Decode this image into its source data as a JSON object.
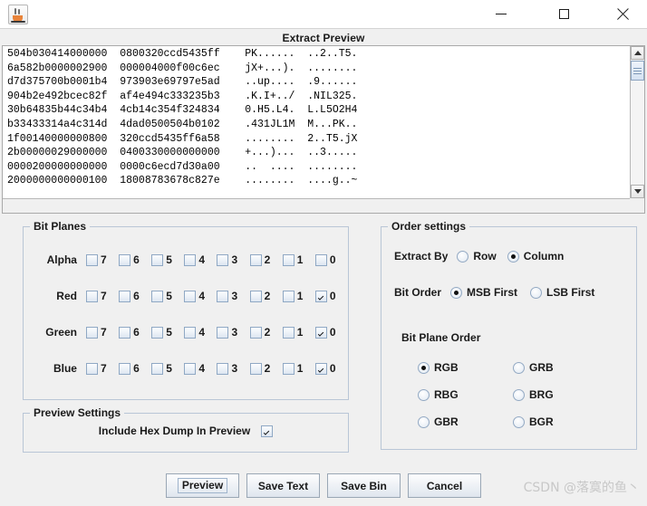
{
  "window": {
    "icon": "java-cup-icon",
    "title": "",
    "minimize_label": "—",
    "maximize_label": "□",
    "close_label": "✕"
  },
  "preview": {
    "header": "Extract Preview",
    "hex_lines": [
      "504b030414000000  0800320ccd5435ff    PK......  ..2..T5.",
      "6a582b0000002900  000004000f00c6ec    jX+...).  ........",
      "d7d375700b0001b4  973903e69797e5ad    ..up....  .9......",
      "904b2e492bcec82f  af4e494c333235b3    .K.I+../  .NIL325.",
      "30b64835b44c34b4  4cb14c354f324834    0.H5.L4.  L.L5O2H4",
      "b33433314a4c314d  4dad0500504b0102    .431JL1M  M...PK..",
      "1f00140000000800  320ccd5435ff6a58    ........  2..T5.jX",
      "2b00000029000000  0400330000000000    +...)...  ..3.....",
      "0000200000000000  0000c6ecd7d30a00    ..  ....  ........",
      "2000000000000100  18008783678c827e    ........  ....g..~"
    ]
  },
  "bit_planes": {
    "legend": "Bit Planes",
    "bit_labels": [
      "7",
      "6",
      "5",
      "4",
      "3",
      "2",
      "1",
      "0"
    ],
    "rows": [
      {
        "channel": "Alpha",
        "checked": [
          false,
          false,
          false,
          false,
          false,
          false,
          false,
          false
        ]
      },
      {
        "channel": "Red",
        "checked": [
          false,
          false,
          false,
          false,
          false,
          false,
          false,
          true
        ]
      },
      {
        "channel": "Green",
        "checked": [
          false,
          false,
          false,
          false,
          false,
          false,
          false,
          true
        ]
      },
      {
        "channel": "Blue",
        "checked": [
          false,
          false,
          false,
          false,
          false,
          false,
          false,
          true
        ]
      }
    ]
  },
  "order_settings": {
    "legend": "Order settings",
    "extract_by": {
      "label": "Extract By",
      "options": [
        "Row",
        "Column"
      ],
      "selected": "Column"
    },
    "bit_order": {
      "label": "Bit Order",
      "options": [
        "MSB First",
        "LSB First"
      ],
      "selected": "MSB First"
    },
    "bit_plane_order": {
      "label": "Bit Plane Order",
      "options": [
        "RGB",
        "GRB",
        "RBG",
        "BRG",
        "GBR",
        "BGR"
      ],
      "selected": "RGB"
    }
  },
  "preview_settings": {
    "legend": "Preview Settings",
    "include_hex_dump": {
      "label": "Include Hex Dump In Preview",
      "checked": true
    }
  },
  "buttons": [
    {
      "name": "preview",
      "label": "Preview",
      "focused": true
    },
    {
      "name": "save-text",
      "label": "Save Text",
      "focused": false
    },
    {
      "name": "save-bin",
      "label": "Save Bin",
      "focused": false
    },
    {
      "name": "cancel",
      "label": "Cancel",
      "focused": false
    }
  ],
  "watermark": "CSDN @落寞的鱼丶",
  "colors": {
    "panel_bg": "#f0f0f0",
    "group_border": "#b9c6d6",
    "text": "#1a1a1a",
    "hex_bg": "#ffffff",
    "scroll_thumb": "#d5e2f2",
    "watermark": "#c8c8c8"
  }
}
